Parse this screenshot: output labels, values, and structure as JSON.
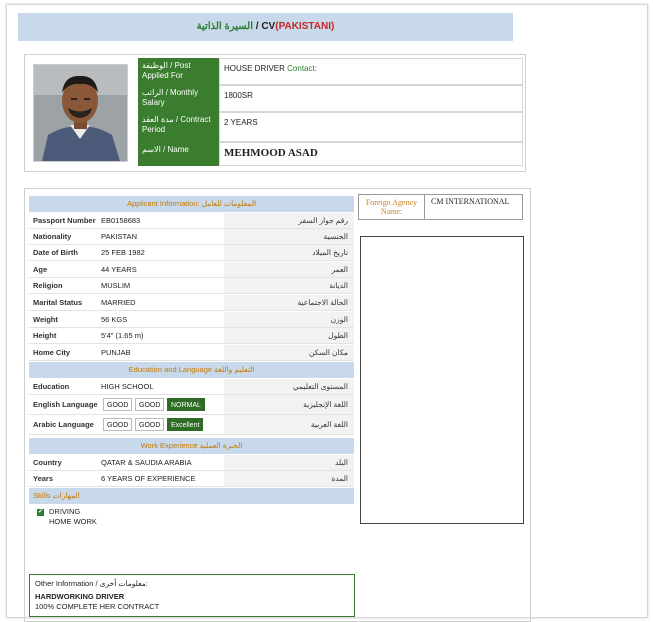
{
  "title": {
    "arabic": "السيرة الذاتية",
    "sep": " / CV",
    "country": "(PAKISTANI)"
  },
  "top": {
    "rows": [
      {
        "key": "الوظيفة / Post Applied For",
        "value": "HOUSE DRIVER",
        "contact": "Contact:"
      },
      {
        "key": "الراتب / Monthly Salary",
        "value": "1800SR"
      },
      {
        "key": "مدة العقد / Contract Period",
        "value": "2 YEARS"
      },
      {
        "key": "الاسم / Name",
        "value": "MEHMOOD ASAD"
      }
    ]
  },
  "applicant": {
    "header": "Applicant Information:  المعلومات للعامل",
    "rows": [
      {
        "key": "Passport Number",
        "value": "EB0158683",
        "ar": "رقم جواز السفر"
      },
      {
        "key": "Nationality",
        "value": "PAKISTAN",
        "ar": "الجنسية"
      },
      {
        "key": "Date of Birth",
        "value": "25 FEB 1982",
        "ar": "تاريخ الميلاد"
      },
      {
        "key": "Age",
        "value": "44   YEARS",
        "ar": "العمر"
      },
      {
        "key": "Religion",
        "value": "MUSLIM",
        "ar": "الديانة"
      },
      {
        "key": "Marital Status",
        "value": "MARRIED",
        "ar": "الحالة الاجتماعية"
      },
      {
        "key": "Weight",
        "value": "56 KGS",
        "ar": "الوزن"
      },
      {
        "key": "Height",
        "value": "5'4\" (1.65 m)",
        "ar": "الطول"
      },
      {
        "key": "Home City",
        "value": "PUNJAB",
        "ar": "مكان السكن"
      }
    ]
  },
  "education": {
    "header": "Education and Language  التعليم واللغة",
    "rows": [
      {
        "key": "Education",
        "value": "HIGH SCHOOL",
        "ar": "المستوى التعليمي"
      }
    ],
    "languages": [
      {
        "key": "English Language",
        "levels": [
          "GOOD",
          "GOOD",
          "NORMAL"
        ],
        "ar": "اللغة الإنجليزية"
      },
      {
        "key": "Arabic Language",
        "levels": [
          "GOOD",
          "GOOD",
          "Excellent"
        ],
        "ar": "اللغة العربية"
      }
    ]
  },
  "work": {
    "header": "Work Experience  الخبرة العملية",
    "rows": [
      {
        "key": "Country",
        "value": "QATAR & SAUDIA ARABIA",
        "ar": "البلد"
      },
      {
        "key": "Years",
        "value": "6  YEARS OF EXPERIENCE",
        "ar": "المدة"
      }
    ]
  },
  "skills": {
    "header": "Skills   المهارات",
    "items": [
      "DRIVING",
      "HOME WORK"
    ]
  },
  "other": {
    "header": "Other Information / معلومات أخرى:",
    "lines": [
      "HARDWORKING DRIVER",
      "100% COMPLETE HER CONTRACT"
    ]
  },
  "agency": {
    "label": "Foreign Agency Name:",
    "value": "CM INTERNATIONAL"
  }
}
